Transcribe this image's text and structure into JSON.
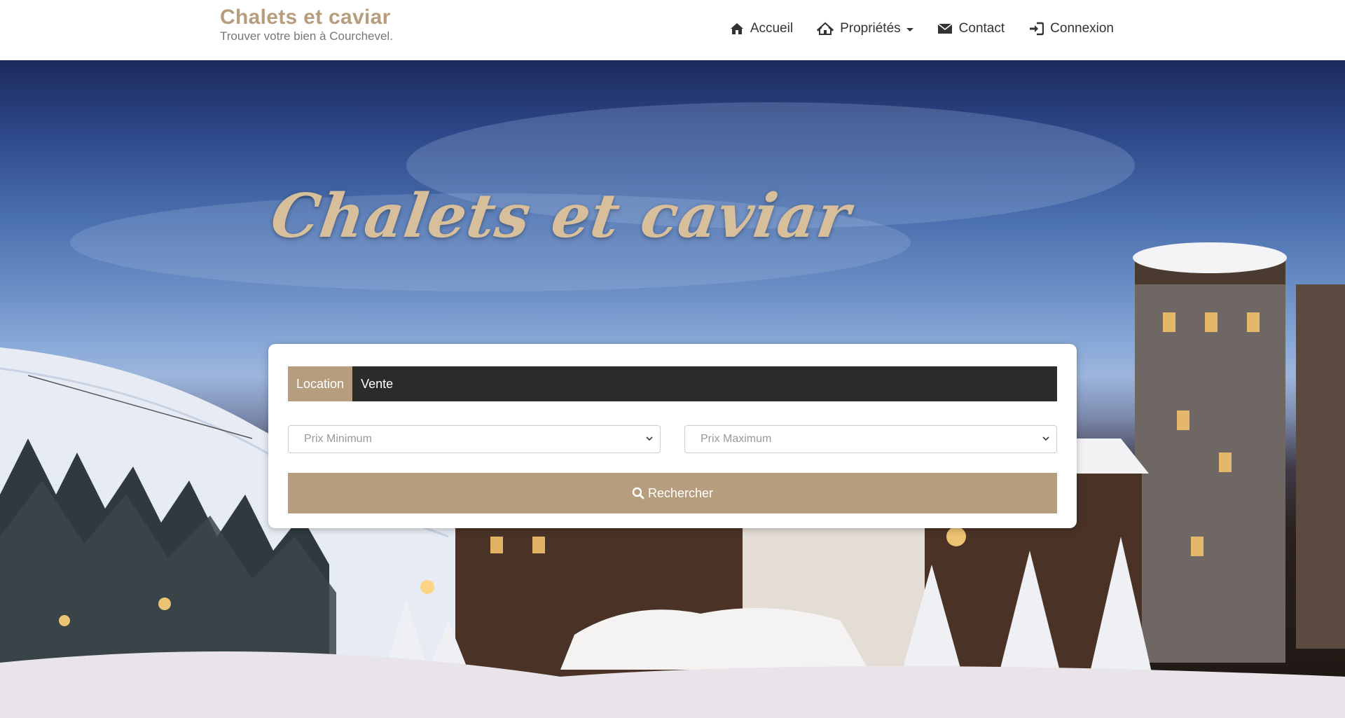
{
  "header": {
    "brand_title": "Chalets et caviar",
    "brand_tagline": "Trouver votre bien à Courchevel.",
    "nav": [
      {
        "label": "Accueil",
        "icon": "home-icon"
      },
      {
        "label": "Propriétés",
        "icon": "properties-icon",
        "dropdown": true
      },
      {
        "label": "Contact",
        "icon": "envelope-icon"
      },
      {
        "label": "Connexion",
        "icon": "login-icon"
      }
    ]
  },
  "hero": {
    "title": "Chalets et caviar"
  },
  "search": {
    "tabs": [
      {
        "label": "Location",
        "active": true
      },
      {
        "label": "Vente",
        "active": false
      }
    ],
    "min_price_placeholder": "Prix Minimum",
    "max_price_placeholder": "Prix Maximum",
    "button_label": "Rechercher"
  },
  "colors": {
    "accent": "#b59d7e",
    "tab_bar": "#2b2b2b",
    "nav_text": "#333333"
  }
}
